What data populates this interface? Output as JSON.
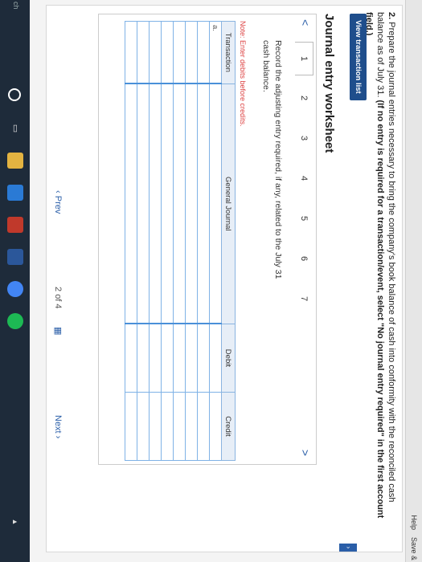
{
  "topbar": {
    "help": "Help",
    "save": "Save &"
  },
  "question": {
    "number": "2.",
    "text": "Prepare the journal entries necessary to bring the company's book balance of cash into conformity with the reconciled cash balance as of July 31.",
    "bold": "(If no entry is required for a transaction/event, select \"No journal entry required\" in the first account field.)"
  },
  "view_button": "View transaction list",
  "worksheet": {
    "title": "Journal entry worksheet",
    "tabs": [
      "1",
      "2",
      "3",
      "4",
      "5",
      "6",
      "7"
    ],
    "active_tab": 0,
    "prev_arrow": "<",
    "next_arrow": ">",
    "instruction": "Record the adjusting entry required, if any, related to the July 31 cash balance.",
    "note": "Note: Enter debits before credits.",
    "table": {
      "headers": [
        "Transaction",
        "General Journal",
        "Debit",
        "Credit"
      ],
      "rows": [
        [
          "a.",
          "",
          "",
          ""
        ],
        [
          "",
          "",
          "",
          ""
        ],
        [
          "",
          "",
          "",
          ""
        ],
        [
          "",
          "",
          "",
          ""
        ],
        [
          "",
          "",
          "",
          ""
        ],
        [
          "",
          "",
          "",
          ""
        ],
        [
          "",
          "",
          "",
          ""
        ],
        [
          "",
          "",
          "",
          ""
        ]
      ]
    }
  },
  "bottom_nav": {
    "prev": "Prev",
    "current": "2",
    "of": "of 4",
    "next": "Next"
  },
  "taskbar": {
    "search_fragment": "ch"
  }
}
